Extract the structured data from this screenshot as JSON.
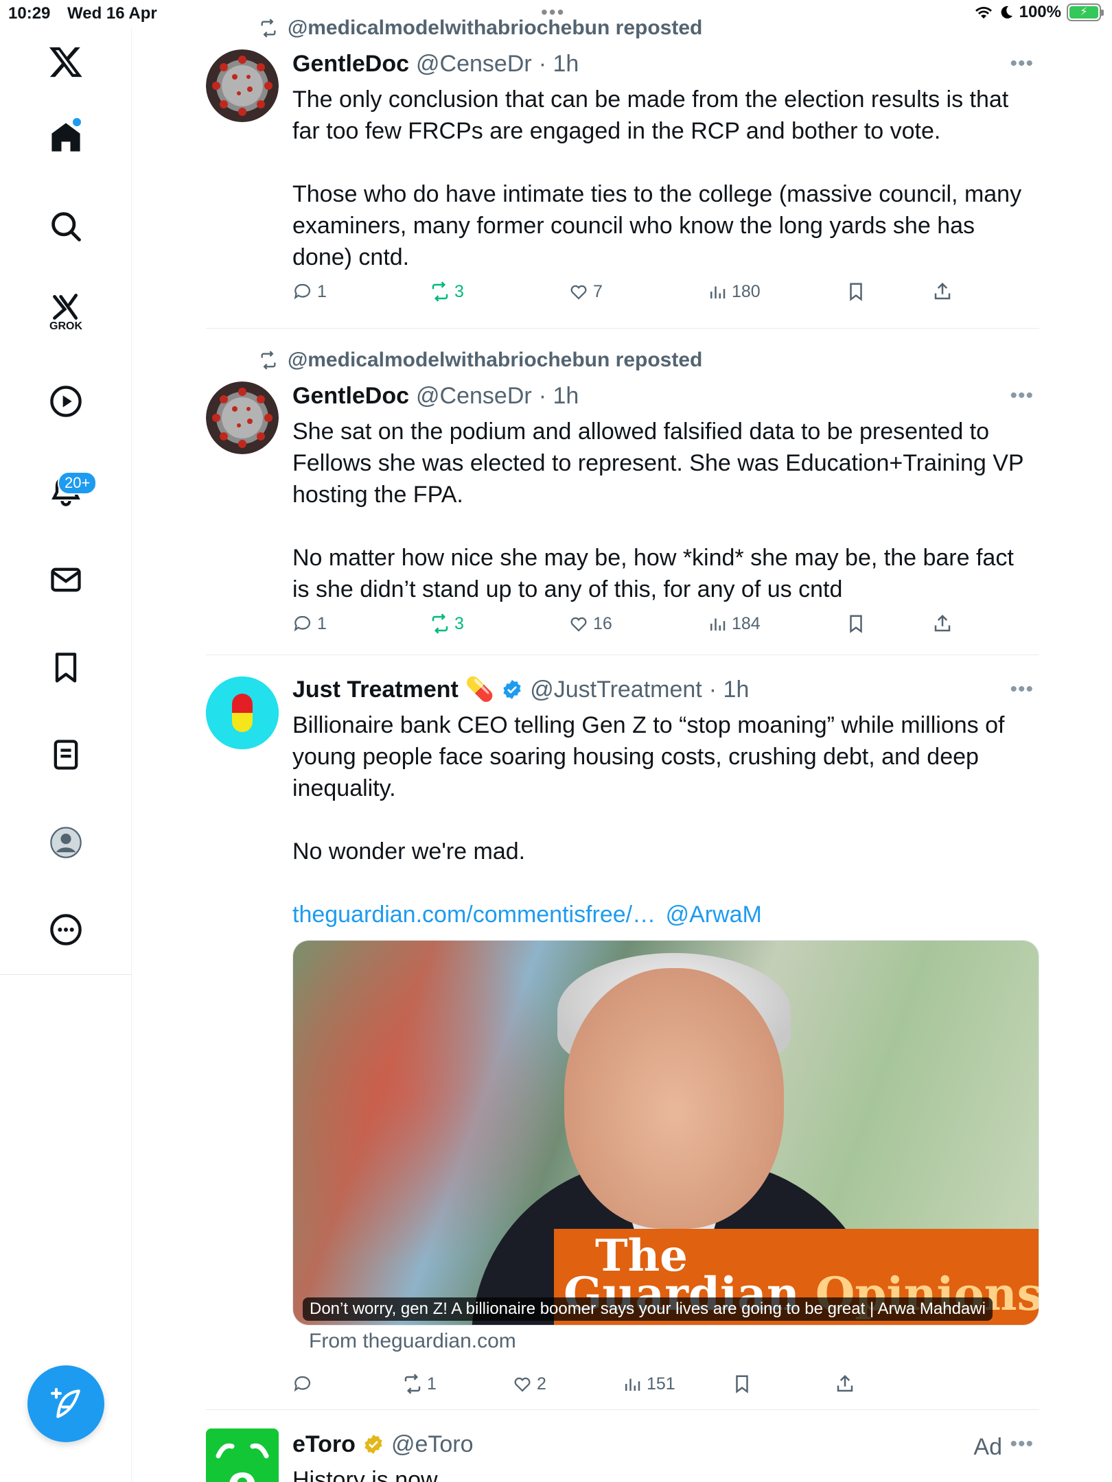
{
  "status_bar": {
    "time": "10:29",
    "date": "Wed 16 Apr",
    "battery": "100%"
  },
  "sidebar": {
    "grok_label": "GROK",
    "notifications_badge": "20+",
    "items": [
      "home",
      "search",
      "grok",
      "videos",
      "notifications",
      "messages",
      "bookmarks",
      "lists",
      "profile",
      "more"
    ]
  },
  "tweets": [
    {
      "repost_by": "@medicalmodelwithabriochebun reposted",
      "name": "GentleDoc",
      "handle": "@CenseDr",
      "time": "· 1h",
      "text": "The only conclusion that can be made from the election results is that far too few FRCPs are engaged in the RCP and bother to vote.\n\nThose who do have intimate ties to the college (massive council, many examiners, many former council who know the long yards she has done) cntd.",
      "replies": "1",
      "reposts": "3",
      "likes": "7",
      "views": "180"
    },
    {
      "repost_by": "@medicalmodelwithabriochebun reposted",
      "name": "GentleDoc",
      "handle": "@CenseDr",
      "time": "· 1h",
      "text": "She sat on the podium and allowed falsified data to be presented to Fellows she was elected to represent. She was Education+Training VP hosting the FPA.\n\nNo matter how nice she may be, how *kind* she may be, the bare fact is she didn’t stand up to any of this, for any of us cntd",
      "replies": "1",
      "reposts": "3",
      "likes": "16",
      "views": "184"
    },
    {
      "name": "Just Treatment",
      "emoji": "💊",
      "handle": "@JustTreatment",
      "time": "· 1h",
      "text": "Billionaire bank CEO telling Gen Z to “stop moaning” while millions of young people face soaring housing costs, crushing debt, and deep inequality.\n\nNo wonder we're mad.",
      "link1": "theguardian.com/commentisfree/…",
      "link2": "@ArwaM",
      "card": {
        "brand_the": "The",
        "brand_guardian": "Guardian",
        "brand_opinions": "Opinions",
        "caption": "Don’t worry, gen Z! A billionaire boomer says your lives are going to be great | Arwa Mahdawi",
        "from": "From theguardian.com"
      },
      "replies": "",
      "reposts": "1",
      "likes": "2",
      "views": "151"
    },
    {
      "name": "eToro",
      "handle": "@eToro",
      "ad_label": "Ad",
      "text": "History is now."
    }
  ],
  "colors": {
    "accent": "#1d9bf0",
    "repost_green": "#00ba7c",
    "guardian_orange": "#e0610f"
  }
}
